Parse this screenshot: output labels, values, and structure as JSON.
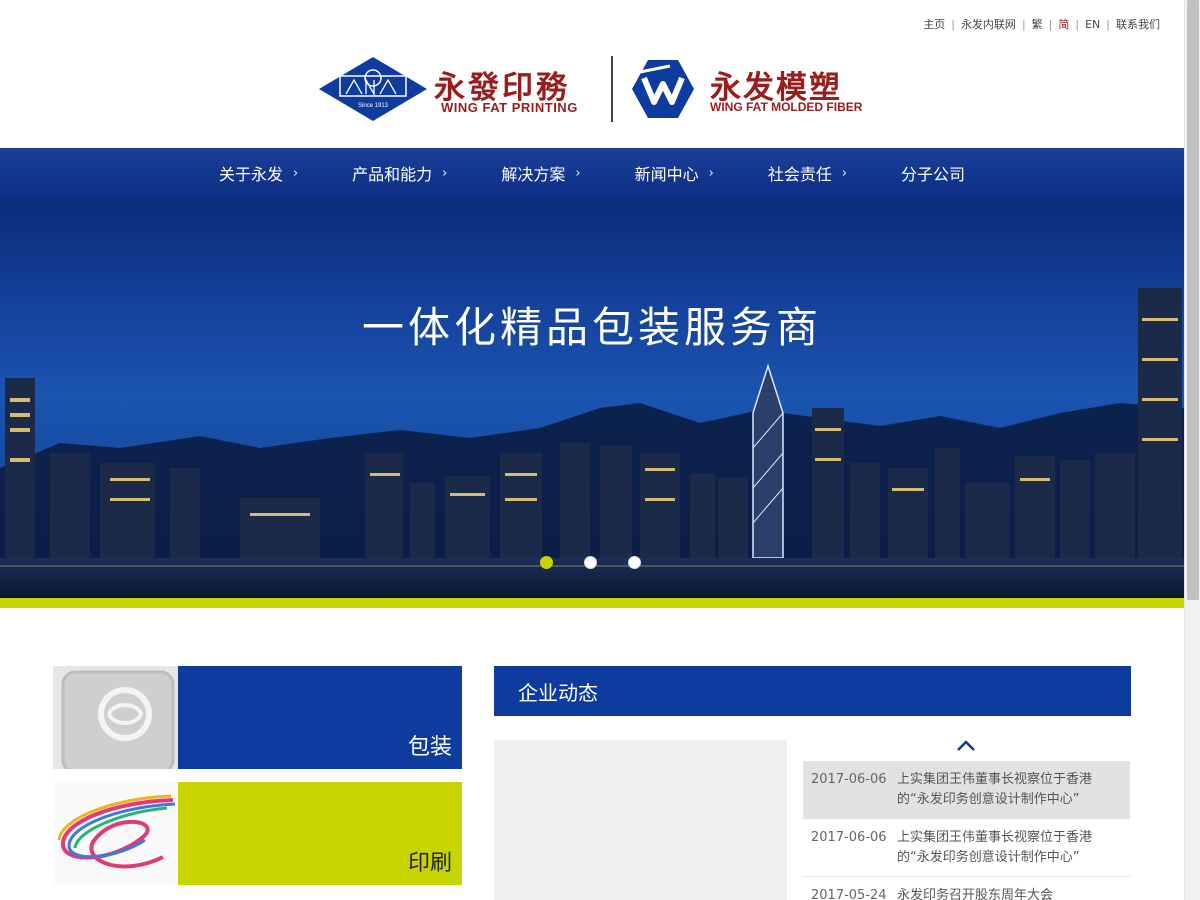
{
  "top_links": {
    "home": "主页",
    "intranet": "永发内联网",
    "traditional": "繁",
    "simplified": "简",
    "english": "EN",
    "contact": "联系我们"
  },
  "logos": {
    "wingfat_printing_cn": "永發印務",
    "wingfat_printing_en": "WING FAT PRINTING",
    "since": "Since 1913",
    "molded_fiber_cn": "永发模塑",
    "molded_fiber_en": "WING FAT MOLDED FIBER"
  },
  "nav": {
    "items": [
      {
        "label": "关于永发",
        "chevron": "›"
      },
      {
        "label": "产品和能力",
        "chevron": "›"
      },
      {
        "label": "解决方案",
        "chevron": "›"
      },
      {
        "label": "新闻中心",
        "chevron": "›"
      },
      {
        "label": "社会责任",
        "chevron": "›"
      },
      {
        "label": "分子公司",
        "chevron": ""
      }
    ]
  },
  "banner": {
    "title": "一体化精品包装服务商",
    "slide_count": 3,
    "active_slide": 1
  },
  "tiles": {
    "packaging": "包装",
    "printing": "印刷"
  },
  "news": {
    "header": "企业动态",
    "items": [
      {
        "date": "2017-06-06",
        "title": "上实集团王伟董事长视察位于香港的“永发印务创意设计制作中心”"
      },
      {
        "date": "2017-06-06",
        "title": "上实集团王伟董事长视察位于香港的“永发印务创意设计制作中心”"
      },
      {
        "date": "2017-05-24",
        "title": "永发印务召开股东周年大会"
      }
    ]
  },
  "colors": {
    "brand_blue": "#0d3b9e",
    "brand_red": "#9a1c1c",
    "accent_lime": "#c8d400"
  },
  "icons": [
    "wing-fat-printing-logo-icon",
    "wing-fat-molded-fiber-logo-icon",
    "chevron-right-icon",
    "chevron-up-icon"
  ]
}
